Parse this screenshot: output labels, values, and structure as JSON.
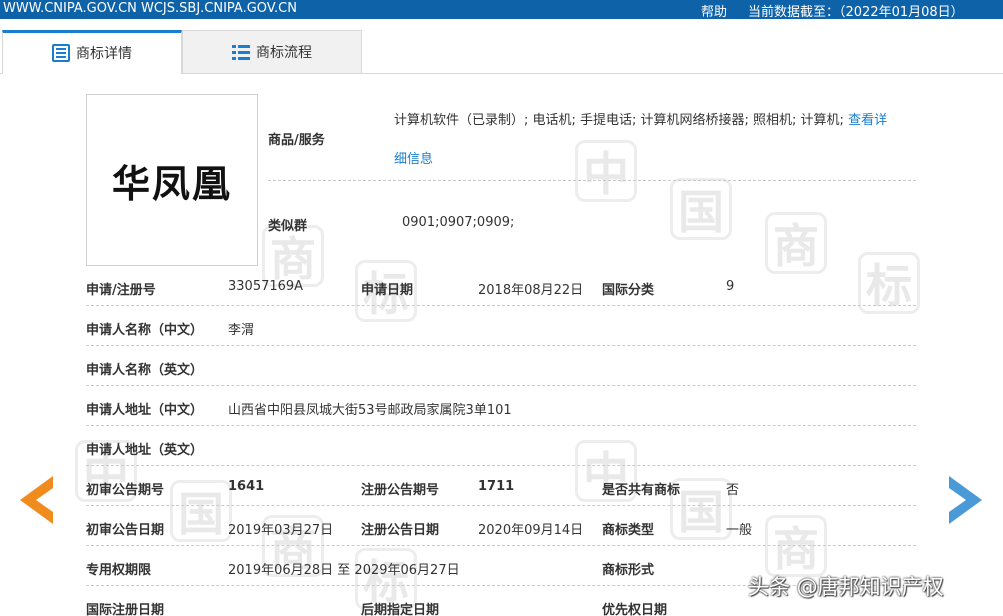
{
  "topbar": {
    "domains": "WWW.CNIPA.GOV.CN WCJS.SBJ.CNIPA.GOV.CN",
    "help": "帮助",
    "as_of": "当前数据截至：（2022年01月08日）"
  },
  "tabs": [
    {
      "label": "商标详情",
      "icon": "document-icon",
      "active": true
    },
    {
      "label": "商标流程",
      "icon": "list-icon",
      "active": false
    }
  ],
  "watermark_char_1": "中",
  "watermark_char_2": "国",
  "watermark_char_3": "商",
  "watermark_char_4": "标",
  "trademark": {
    "logo_text": "华凤凰",
    "goods_label": "商品/服务",
    "goods_value": "计算机软件（已录制）; 电话机; 手提电话; 计算机网络桥接器; 照相机; 计算机;",
    "goods_link_a": "查看详",
    "goods_link_b": "细信息",
    "similar_label": "类似群",
    "similar_value": "0901;0907;0909;"
  },
  "details": {
    "reg_no_label": "申请/注册号",
    "reg_no": "33057169A",
    "app_date_label": "申请日期",
    "app_date": "2018年08月22日",
    "intl_class_label": "国际分类",
    "intl_class": "9",
    "applicant_cn_label": "申请人名称（中文）",
    "applicant_cn": "李渭",
    "applicant_en_label": "申请人名称（英文）",
    "applicant_en": "",
    "address_cn_label": "申请人地址（中文）",
    "address_cn": "山西省中阳县凤城大街53号邮政局家属院3单101",
    "address_en_label": "申请人地址（英文）",
    "address_en": "",
    "prelim_no_label": "初审公告期号",
    "prelim_no": "1641",
    "reg_pub_no_label": "注册公告期号",
    "reg_pub_no": "1711",
    "shared_label": "是否共有商标",
    "shared": "否",
    "prelim_date_label": "初审公告日期",
    "prelim_date": "2019年03月27日",
    "reg_pub_date_label": "注册公告日期",
    "reg_pub_date": "2020年09月14日",
    "tm_type_label": "商标类型",
    "tm_type": "一般",
    "exclusive_label": "专用权期限",
    "exclusive": "2019年06月28日 至 2029年06月27日",
    "tm_form_label": "商标形式",
    "tm_form": "",
    "intl_reg_date_label": "国际注册日期",
    "later_designation_label": "后期指定日期",
    "priority_date_label": "优先权日期"
  },
  "nav": {
    "prev": "chevron-left-icon",
    "next": "chevron-right-icon"
  },
  "credit": "头条 @唐邦知识产权",
  "colors": {
    "topbar": "#0e62a8",
    "accent": "#1a7ed0",
    "arrow_prev": "#f08c1e",
    "arrow_next": "#4a9ad8"
  }
}
